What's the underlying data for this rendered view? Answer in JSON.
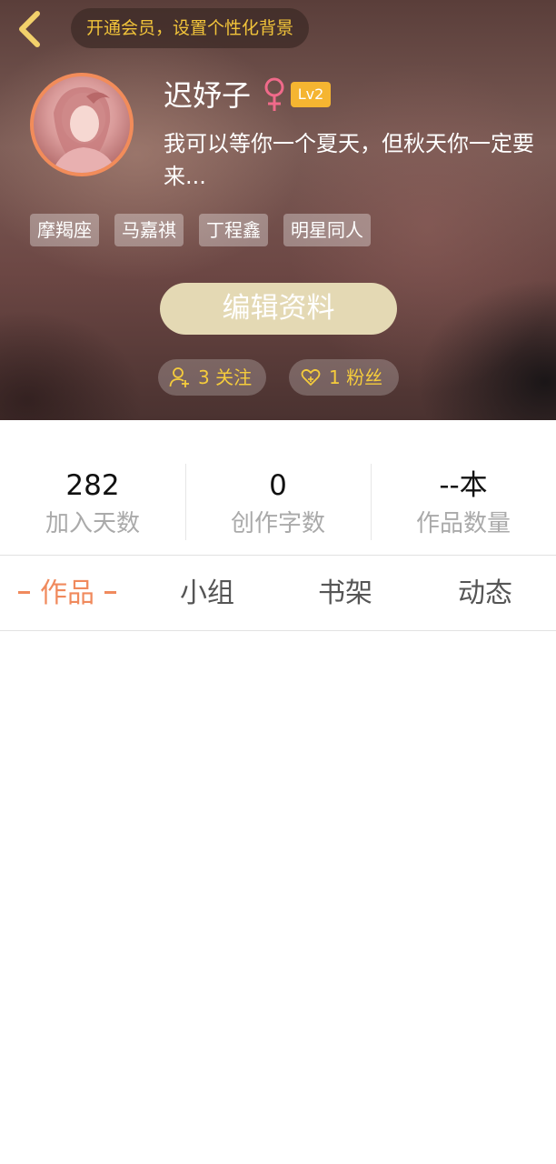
{
  "header": {
    "back_icon": "chevron-left-icon",
    "vip_banner": "开通会员，设置个性化背景",
    "username": "迟妤子",
    "gender_icon": "female-symbol-icon",
    "level": "Lv2",
    "signature": "我可以等你一个夏天，但秋天你一定要来...",
    "tags": [
      "摩羯座",
      "马嘉祺",
      "丁程鑫",
      "明星同人"
    ],
    "edit_button": "编辑资料",
    "follow_icon": "user-add-icon",
    "follow_label": "3 关注",
    "fans_icon": "heart-add-icon",
    "fans_label": "1 粉丝"
  },
  "stats": [
    {
      "value": "282",
      "label": "加入天数"
    },
    {
      "value": "0",
      "label": "创作字数"
    },
    {
      "value": "--本",
      "label": "作品数量"
    }
  ],
  "tabs": [
    {
      "label": "作品",
      "active": true
    },
    {
      "label": "小组",
      "active": false
    },
    {
      "label": "书架",
      "active": false
    },
    {
      "label": "动态",
      "active": false
    }
  ],
  "colors": {
    "accent": "#f08a5d",
    "gold_text": "#f2c43a",
    "level_badge": "#f5b531",
    "edit_button_bg": "#e4d9b4",
    "gender_icon": "#f06a8a"
  }
}
